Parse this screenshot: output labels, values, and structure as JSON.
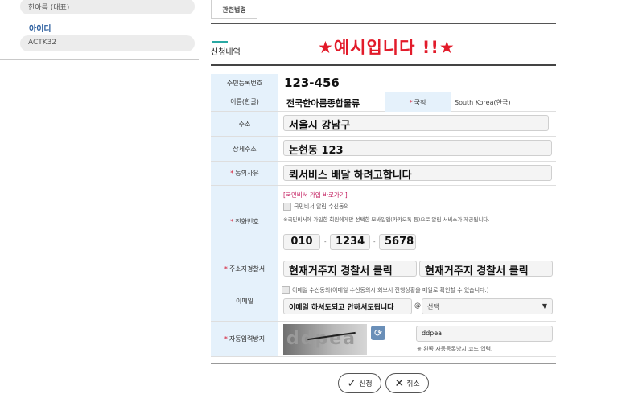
{
  "left": {
    "item1": "한아름 (대표)",
    "label": "아이디",
    "item2": "ACTK32"
  },
  "tab": "관련법령",
  "section_title": "신청내역",
  "example_text": "★예시입니다 !!★",
  "form": {
    "id_label": "주민등록번호",
    "id_value": "123-456",
    "name_label": "이름(한글)",
    "name_value": "전국한아름종합물류",
    "nation_label": "국적",
    "nation_value": "South Korea(한국)",
    "addr_label": "주소",
    "addr_value": "서울시 강남구",
    "addr2_label": "상세주소",
    "addr2_value": "논현동 123",
    "reason_label": "동의사유",
    "reason_value": "퀵서비스 배달 하려고합니다",
    "phone_label": "전화번호",
    "phone_link": "[국민비서 가입 바로가기]",
    "phone_consent": "국민비서 알림 수신동의",
    "phone_notice": "※국민비서에 가입한 회원에게만 선택한 모바일앱(카카오톡 등)으로 알림 서비스가 제공됩니다.",
    "phone1": "010",
    "phone2": "1234",
    "phone3": "5678",
    "phone_sep": "-",
    "police_label": "주소지경찰서",
    "police_value1": "현재거주지 경찰서 클릭",
    "police_value2": "현재거주지 경찰서 클릭",
    "email_label": "이메일",
    "email_consent": "이메일 수신동의(이메일 수신동의시 회보서 진행상황을 메일로 확인할 수 있습니다.)",
    "email_id": "이메일 하셔도되고 안하셔도됩니다",
    "email_at": "@",
    "email_domain": "선택",
    "captcha_label": "자동입력방지",
    "captcha_text": "ddpea",
    "captcha_input": "ddpea",
    "captcha_note": "※ 왼쪽 자동등록방지 코드 입력."
  },
  "buttons": {
    "apply": "신청",
    "cancel": "취소"
  },
  "colors": {
    "label_bg": "#e5f1fb",
    "required": "#d4112a",
    "example": "#e21b2a",
    "accent": "#2aa9a4",
    "link": "#c2185b"
  },
  "icons": {
    "refresh": "refresh-icon",
    "check": "check-icon",
    "close": "close-icon",
    "dropdown": "chevron-down-icon"
  }
}
